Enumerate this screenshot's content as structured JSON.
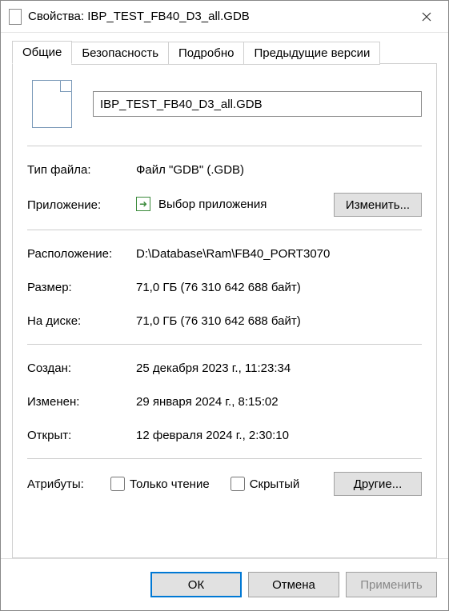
{
  "window": {
    "title": "Свойства: IBP_TEST_FB40_D3_all.GDB"
  },
  "tabs": {
    "general": "Общие",
    "security": "Безопасность",
    "details": "Подробно",
    "previous": "Предыдущие версии"
  },
  "file": {
    "name": "IBP_TEST_FB40_D3_all.GDB"
  },
  "labels": {
    "filetype": "Тип файла:",
    "application": "Приложение:",
    "location": "Расположение:",
    "size": "Размер:",
    "sizeondisk": "На диске:",
    "created": "Создан:",
    "modified": "Изменен:",
    "accessed": "Открыт:",
    "attributes": "Атрибуты:",
    "readonly": "Только чтение",
    "hidden": "Скрытый"
  },
  "values": {
    "filetype": "Файл \"GDB\" (.GDB)",
    "application": "Выбор приложения",
    "location": "D:\\Database\\Ram\\FB40_PORT3070",
    "size": "71,0 ГБ (76 310 642 688 байт)",
    "sizeondisk": "71,0 ГБ (76 310 642 688 байт)",
    "created": "25 декабря 2023 г., 11:23:34",
    "modified": "29 января 2024 г., 8:15:02",
    "accessed": "12 февраля 2024 г., 2:30:10"
  },
  "buttons": {
    "change": "Изменить...",
    "other": "Другие...",
    "ok": "ОК",
    "cancel": "Отмена",
    "apply": "Применить"
  }
}
